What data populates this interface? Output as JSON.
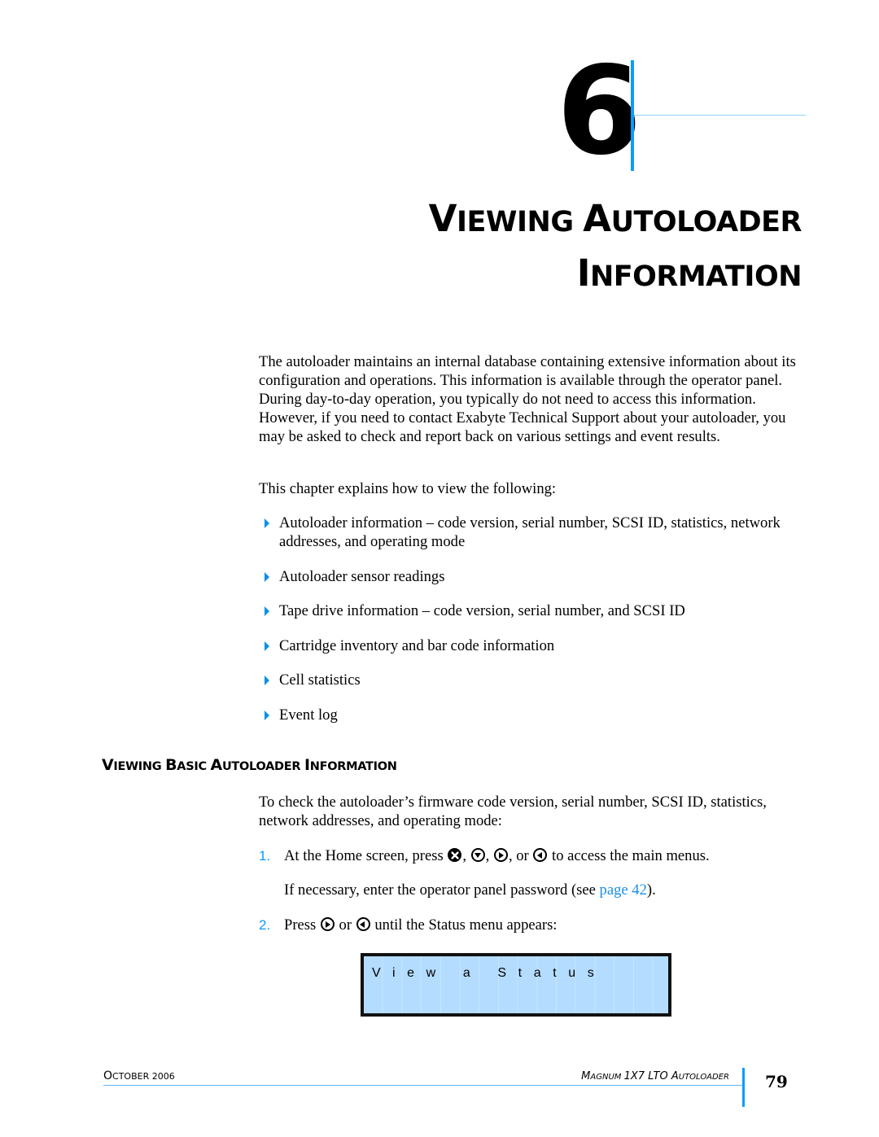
{
  "chapter": {
    "number": "6",
    "title_line1": [
      {
        "cap": "V",
        "rest": "IEWING "
      },
      {
        "cap": "A",
        "rest": "UTOLOADER"
      }
    ],
    "title_line2": [
      {
        "cap": "I",
        "rest": "NFORMATION"
      }
    ]
  },
  "intro": {
    "paragraph": "The autoloader maintains an internal database containing extensive information about its configuration and operations. This information is available through the operator panel. During day-to-day operation, you typically do not need to access this information. However, if you need to contact Exabyte Technical Support about your autoloader, you may be asked to check and report back on various settings and event results.",
    "lead": "This chapter explains how to view the following:",
    "bullets": [
      "Autoloader information – code version, serial number, SCSI ID, statistics, network addresses, and operating mode",
      "Autoloader sensor readings",
      "Tape drive information – code version, serial number, and SCSI ID",
      "Cartridge inventory and bar code information",
      "Cell statistics",
      "Event log"
    ]
  },
  "section": {
    "heading": [
      {
        "cap": "V",
        "rest": "IEWING "
      },
      {
        "cap": "B",
        "rest": "ASIC "
      },
      {
        "cap": "A",
        "rest": "UTOLOADER "
      },
      {
        "cap": "I",
        "rest": "NFORMATION"
      }
    ],
    "intro": "To check the autoloader’s firmware code version, serial number, SCSI ID, statistics, network addresses, and operating mode:",
    "steps": [
      {
        "num": "1.",
        "text_before": "At the Home screen, press ",
        "sep1": ", ",
        "sep2": ", ",
        "sep3": ", or ",
        "text_after": " to access the main menus.",
        "icons": [
          "enter-button-icon",
          "down-arrow-button-icon",
          "right-arrow-button-icon",
          "left-arrow-button-icon"
        ],
        "note_before": "If necessary, enter the operator panel password (see ",
        "note_link": "page 42",
        "note_after": ")."
      },
      {
        "num": "2.",
        "text_before": "Press ",
        "sep1": " or ",
        "text_after": " until the Status menu appears:",
        "icons": [
          "right-arrow-button-icon",
          "left-arrow-button-icon"
        ]
      }
    ],
    "lcd_text": "View a Status"
  },
  "footer": {
    "left": [
      {
        "cap": "O",
        "rest": "CTOBER "
      },
      {
        "cap": "2006",
        "rest": ""
      }
    ],
    "right": [
      {
        "cap": "M",
        "rest": "AGNUM "
      },
      {
        "cap": "1X7 LTO ",
        "rest": ""
      },
      {
        "cap": "A",
        "rest": "UTOLOADER"
      }
    ],
    "page_number": "79"
  },
  "colors": {
    "accent": "#0a9bff",
    "link": "#1a8fe6",
    "lcd_background": "#b4dcff"
  }
}
